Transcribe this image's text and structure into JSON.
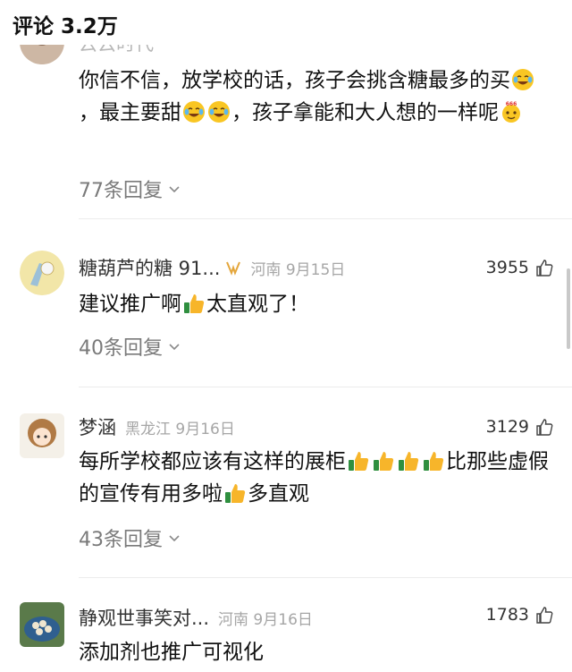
{
  "header": {
    "title": "评论 3.2万"
  },
  "comments": [
    {
      "name": "云云时代",
      "meta": "",
      "likes": "",
      "segments": [
        {
          "t": "你信不信，放学校的话，孩子会挑含糖最多的买"
        },
        {
          "e": "laugh-cry-emoji"
        },
        {
          "t": "，最主要甜"
        },
        {
          "e": "laugh-cry-emoji"
        },
        {
          "e": "laugh-cry-emoji"
        },
        {
          "t": "，孩子拿能和大人想的一样呢"
        },
        {
          "e": "666-emoji"
        }
      ],
      "replies": "77条回复"
    },
    {
      "name": "糖葫芦的糖 91...",
      "meta": "河南 9月15日",
      "likes": "3955",
      "segments": [
        {
          "t": "建议推广啊"
        },
        {
          "e": "thumbs-up-emoji"
        },
        {
          "t": "太直观了！"
        }
      ],
      "replies": "40条回复"
    },
    {
      "name": "梦涵",
      "meta": "黑龙江 9月16日",
      "likes": "3129",
      "segments": [
        {
          "t": "每所学校都应该有这样的展柜"
        },
        {
          "e": "thumbs-up-emoji"
        },
        {
          "e": "thumbs-up-emoji"
        },
        {
          "e": "thumbs-up-emoji"
        },
        {
          "e": "thumbs-up-emoji"
        },
        {
          "t": "比那些虚假的宣传有用多啦"
        },
        {
          "e": "thumbs-up-emoji"
        },
        {
          "t": "多直观"
        }
      ],
      "replies": "43条回复"
    },
    {
      "name": "静观世事笑对...",
      "meta": "河南 9月16日",
      "likes": "1783",
      "segments": [
        {
          "t": "添加剂也推广可视化"
        }
      ],
      "replies": ""
    }
  ]
}
